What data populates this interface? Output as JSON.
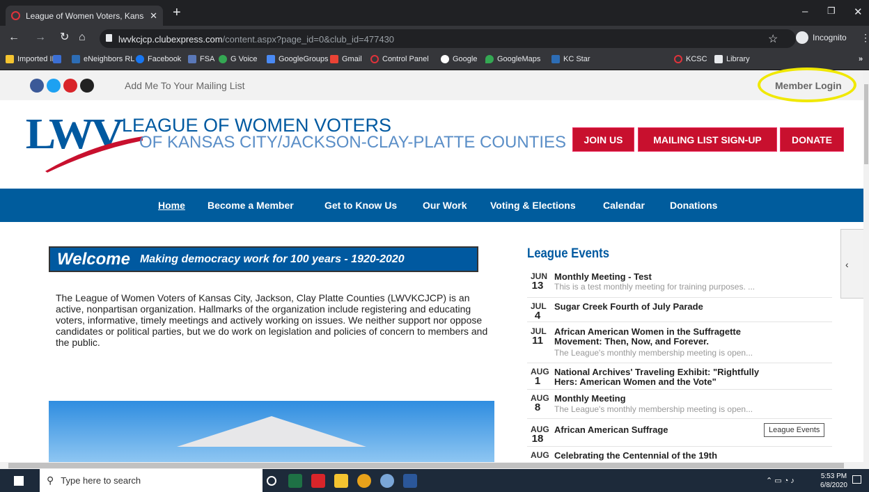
{
  "browser": {
    "tab_title": "League of Women Voters, Kansas",
    "url_host": "lwvkcjcp.clubexpress.com",
    "url_path": "/content.aspx?page_id=0&club_id=477430",
    "incognito_label": "Incognito",
    "bookmarks": [
      "Imported IE",
      "eNeighbors RL",
      "Facebook",
      "FSA",
      "G Voice",
      "GoogleGroups",
      "Gmail",
      "Control Panel",
      "Google",
      "GoogleMaps",
      "KC Star",
      "KCSC",
      "Library"
    ]
  },
  "top": {
    "mailing_link": "Add Me To Your Mailing List",
    "member_login": "Member Login"
  },
  "logo": {
    "mark": "LWV",
    "line1": "LEAGUE OF WOMEN VOTERS",
    "line2": "OF KANSAS CITY/JACKSON-CLAY-PLATTE COUNTIES"
  },
  "header_buttons": {
    "join": "JOIN US",
    "mailing": "MAILING LIST SIGN-UP",
    "donate": "DONATE"
  },
  "nav": [
    "Home",
    "Become a Member",
    "Get to Know Us",
    "Our Work",
    "Voting & Elections",
    "Calendar",
    "Donations"
  ],
  "welcome": {
    "title": "Welcome",
    "tagline": "Making democracy work for 100 years  -  1920-2020",
    "intro": "The League of Women Voters of Kansas City, Jackson, Clay Platte Counties (LWVKCJCP) is an active, nonpartisan organization. Hallmarks of the organization include registering and educating voters, informative, timely meetings and actively working on issues. We neither support nor oppose candidates or political parties, but we do work on legislation and policies of concern to members and the public."
  },
  "events": {
    "heading": "League Events",
    "tooltip": "League Events",
    "items": [
      {
        "month": "JUN",
        "day": "13",
        "title": "Monthly Meeting - Test",
        "desc": "This is a test monthly meeting for training purposes. ..."
      },
      {
        "month": "JUL",
        "day": "4",
        "title": "Sugar Creek Fourth of July Parade",
        "desc": ""
      },
      {
        "month": "JUL",
        "day": "11",
        "title": "African American Women in the Suffragette",
        "title2": "Movement: Then, Now, and Forever.",
        "desc": "The League's monthly membership meeting is open..."
      },
      {
        "month": "AUG",
        "day": "1",
        "title": "National Archives' Traveling Exhibit: \"Rightfully",
        "title2": "Hers: American Women and the Vote\"",
        "desc": ""
      },
      {
        "month": "AUG",
        "day": "8",
        "title": "Monthly Meeting",
        "desc": "The League's monthly membership meeting is open..."
      },
      {
        "month": "AUG",
        "day": "18",
        "title": "African American Suffrage",
        "desc": ""
      },
      {
        "month": "AUG",
        "day": "",
        "title": "Celebrating the Centennial of the 19th",
        "desc": ""
      }
    ]
  },
  "taskbar": {
    "search_placeholder": "Type here to search",
    "time": "5:53 PM",
    "date": "6/8/2020"
  }
}
